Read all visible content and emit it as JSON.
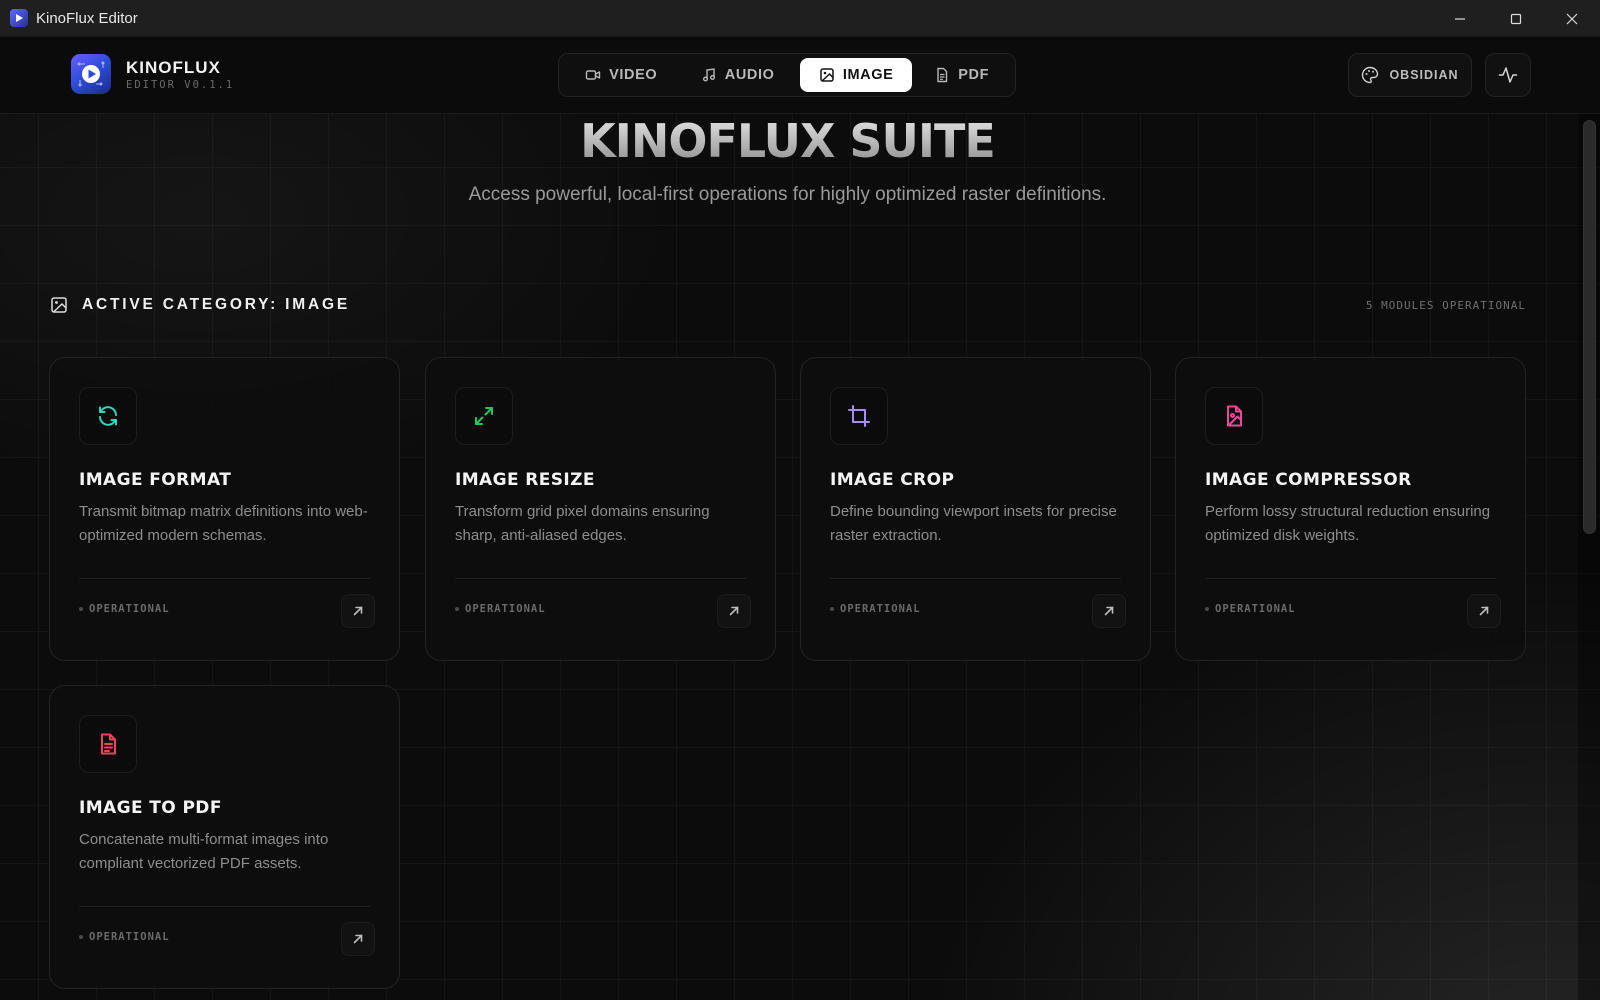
{
  "window": {
    "title": "KinoFlux Editor"
  },
  "brand": {
    "name": "KINOFLUX",
    "version": "EDITOR V0.1.1"
  },
  "tabs": [
    {
      "label": "VIDEO",
      "icon": "video-icon",
      "active": false
    },
    {
      "label": "AUDIO",
      "icon": "music-note-icon",
      "active": false
    },
    {
      "label": "IMAGE",
      "icon": "image-icon",
      "active": true
    },
    {
      "label": "PDF",
      "icon": "file-text-icon",
      "active": false
    }
  ],
  "theme": {
    "label": "OBSIDIAN",
    "icon": "palette-icon"
  },
  "activity": {
    "icon": "activity-pulse-icon"
  },
  "hero": {
    "title": "KINOFLUX SUITE",
    "subtitle": "Access powerful, local-first operations for highly optimized raster definitions."
  },
  "category": {
    "label": "ACTIVE CATEGORY: IMAGE",
    "count": "5 MODULES OPERATIONAL"
  },
  "colors": {
    "format": "#2dd4bf",
    "resize": "#22c55e",
    "crop": "#a78bfa",
    "compressor": "#ec4899",
    "topdf": "#f43f5e"
  },
  "cards": [
    {
      "title": "IMAGE FORMAT",
      "desc": "Transmit bitmap matrix definitions into web-optimized modern schemas.",
      "status": "OPERATIONAL",
      "icon": "refresh-icon"
    },
    {
      "title": "IMAGE RESIZE",
      "desc": "Transform grid pixel domains ensuring sharp, anti-aliased edges.",
      "status": "OPERATIONAL",
      "icon": "expand-arrows-icon"
    },
    {
      "title": "IMAGE CROP",
      "desc": "Define bounding viewport insets for precise raster extraction.",
      "status": "OPERATIONAL",
      "icon": "crop-icon"
    },
    {
      "title": "IMAGE COMPRESSOR",
      "desc": "Perform lossy structural reduction ensuring optimized disk weights.",
      "status": "OPERATIONAL",
      "icon": "file-image-icon"
    },
    {
      "title": "IMAGE TO PDF",
      "desc": "Concatenate multi-format images into compliant vectorized PDF assets.",
      "status": "OPERATIONAL",
      "icon": "file-text-icon"
    }
  ]
}
